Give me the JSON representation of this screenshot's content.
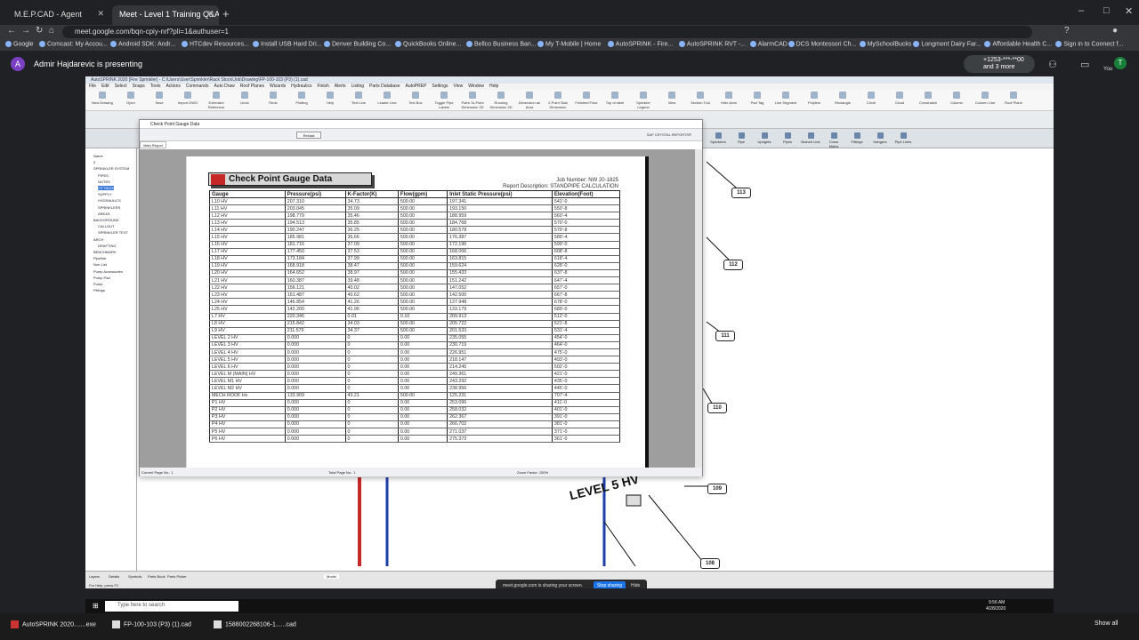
{
  "browser": {
    "tabs": [
      {
        "title": "M.E.P.CAD - Agent",
        "active": false
      },
      {
        "title": "Meet - Level 1 Training Q&A",
        "active": true
      }
    ],
    "url": "meet.google.com/bqn-cpiy-nrf?pli=1&authuser=1",
    "bookmarks": [
      "Google",
      "Comcast: My Accou...",
      "Android SDK: Andr...",
      "HTCdev Resources...",
      "Install USB Hard Dri...",
      "Denver Building Co...",
      "QuickBooks Online...",
      "Bellco Business Ban...",
      "My T-Mobile | Home",
      "AutoSPRINK - Fire...",
      "AutoSPRINK RVT -...",
      "AlarmCAD",
      "DCS Montessori Ch...",
      "MySchoolBucks",
      "Longmont Dairy Far...",
      "Affordable Health C...",
      "Sign in to Connect f..."
    ]
  },
  "meet": {
    "presenter_initial": "A",
    "presenter_text": "Admir Hajdarevic is presenting",
    "phone_text_1": "+1253-***-**00",
    "phone_text_2": "and 3 more",
    "you_label": "You",
    "you_initial": "T",
    "share_notice": "meet.google.com is sharing your screen.",
    "stop_sharing": "Stop sharing",
    "hide": "Hide"
  },
  "app": {
    "title": "AutoSPRINK 2020 [Fire Sprinkler] - C:\\Users\\User\\Sprinkler\\Rack Stock\\Job\\Drawing\\FP-100-103 (P3) (1).cad",
    "menu": [
      "File",
      "Edit",
      "Select",
      "Snaps",
      "Tools",
      "Actions",
      "Commands",
      "Auto Draw",
      "Roof Planes",
      "Wizards",
      "Hydraulics",
      "Finish",
      "Alerts",
      "Listing",
      "Parts Database",
      "AutoPREP",
      "Settings",
      "View",
      "Window",
      "Help"
    ],
    "ribbon": [
      "New Drawing",
      "Open",
      "Save",
      "Import DWG",
      "Extended Reference",
      "Undo",
      "Redo",
      "Plotting",
      "Help",
      "Text Line",
      "Leader Line",
      "Text Box",
      "Toggle Pipe Labels",
      "Point-To-Point Dimension 2D",
      "Running Dimension 2D",
      "Dimension an Area",
      "2-Point Slab Dimension",
      "Finished Floor",
      "Top of steel",
      "Sprinkler Legend",
      "View",
      "Section Tool",
      "Hide Area",
      "Part Tag",
      "Line Segment",
      "Polyline",
      "Rectangle",
      "Circle",
      "Cloud",
      "Crosshatch",
      "Column",
      "Column Line",
      "Roof Plane"
    ],
    "ribbon3": [
      "Sprinklers",
      "Pipe",
      "Uprights",
      "Pipes",
      "Branch Line",
      "Cross Mains",
      "Fittings",
      "Hangers",
      "Pipe Lines"
    ],
    "tree": [
      "Name",
      "0",
      "SPRINKLER SYSTEM",
      "PIPES",
      "NOTES",
      "FITTINGS",
      "SUPPLY",
      "HYDRAULICS",
      "SPRINKLERS",
      "AREAS",
      "BACKGROUND",
      "CALLOUT",
      "SPRINKLER TEXT",
      "ARCH",
      "DRAFTING",
      "BENCHMARK",
      "Pipeline",
      "Non-List",
      "Pump Accessories",
      "Pump Pad",
      "Pump",
      "Fittings"
    ],
    "bottom_tabs": [
      "Layers",
      "Details",
      "Symbols",
      "Parts Book",
      "Parts Picker"
    ],
    "model_tab": "Model",
    "status_help": "For Help, press F1",
    "labels": {
      "l113": "113",
      "l112": "112",
      "l111": "111",
      "l110": "110",
      "l109": "109",
      "l108": "108",
      "level5": "LEVEL 5 HV"
    }
  },
  "report": {
    "window_title": "Check Point Gauge Data",
    "reload": "Reload",
    "tab": "Main Report",
    "crystal": "SAP CRYSTAL REPORTS®",
    "heading": "Check Point Gauge Data",
    "job_number": "Job Number: NW 20-1825",
    "description": "Report Description: STANDPIPE CALCULATION",
    "columns": [
      "Gauge",
      "Pressure(psi)",
      "K-Factor(K)",
      "Flow(gpm)",
      "Inlet Static Pressure(psi)",
      "Elevation(Foot)"
    ],
    "rows": [
      [
        "L10 HV",
        "207.310",
        "34.73",
        "500.00",
        "197.341",
        "541'-0"
      ],
      [
        "L11 HV",
        "203.045",
        "35.09",
        "500.00",
        "193.150",
        "550'-8"
      ],
      [
        "L12 HV",
        "198.779",
        "35.46",
        "500.00",
        "188.959",
        "560'-4"
      ],
      [
        "L13 HV",
        "194.513",
        "35.85",
        "500.00",
        "184.768",
        "570'-0"
      ],
      [
        "L14 HV",
        "190.247",
        "36.25",
        "500.00",
        "180.578",
        "579'-8"
      ],
      [
        "L15 HV",
        "185.981",
        "36.66",
        "500.00",
        "176.387",
        "589'-4"
      ],
      [
        "L16 HV",
        "181.716",
        "37.09",
        "500.00",
        "172.196",
        "599'-0"
      ],
      [
        "L17 HV",
        "177.450",
        "37.53",
        "500.00",
        "168.006",
        "608'-8"
      ],
      [
        "L18 HV",
        "173.184",
        "37.99",
        "500.00",
        "163.815",
        "618'-4"
      ],
      [
        "L19 HV",
        "168.918",
        "38.47",
        "500.00",
        "159.624",
        "628'-0"
      ],
      [
        "L20 HV",
        "164.652",
        "38.97",
        "500.00",
        "155.433",
        "637'-8"
      ],
      [
        "L21 HV",
        "160.387",
        "39.48",
        "500.00",
        "151.242",
        "647'-4"
      ],
      [
        "L22 HV",
        "156.121",
        "40.02",
        "500.00",
        "147.052",
        "657'-0"
      ],
      [
        "L23 HV",
        "151.487",
        "40.62",
        "500.00",
        "142.500",
        "667'-8"
      ],
      [
        "L24 HV",
        "146.854",
        "41.26",
        "500.00",
        "137.948",
        "678'-0"
      ],
      [
        "L25 HV",
        "142.200",
        "41.96",
        "500.00",
        "133.179",
        "689'-0"
      ],
      [
        "L7 HV",
        "220.346",
        "0.01",
        "0.10",
        "209.913",
        "512'-0"
      ],
      [
        "L8 HV",
        "215.842",
        "34.03",
        "500.00",
        "205.722",
        "521'-8"
      ],
      [
        "L9 HV",
        "211.576",
        "34.37",
        "500.00",
        "201.533",
        "531'-4"
      ],
      [
        "LEVEL 2 HV",
        "0.000",
        "0",
        "0.00",
        "235.055",
        "454'-0"
      ],
      [
        "LEVEL 3 HV",
        "0.000",
        "0",
        "0.00",
        "230.719",
        "464'-0"
      ],
      [
        "LEVEL 4 HV",
        "0.000",
        "0",
        "0.00",
        "226.951",
        "475'-0"
      ],
      [
        "LEVEL 5 HV",
        "0.000",
        "0",
        "0.00",
        "218.147",
        "493'-0"
      ],
      [
        "LEVEL 6 HV",
        "0.000",
        "0",
        "0.00",
        "214.245",
        "502'-0"
      ],
      [
        "LEVEL M (MAIN) HV",
        "0.000",
        "0",
        "0.00",
        "249.361",
        "421'-0"
      ],
      [
        "LEVEL M1 HV",
        "0.000",
        "0",
        "0.00",
        "243.292",
        "435'-0"
      ],
      [
        "LEVEL M2 HV",
        "0.000",
        "0",
        "0.00",
        "238.956",
        "445'-0"
      ],
      [
        "MECH ROOF Hv",
        "133.909",
        "43.21",
        "500.00",
        "125.231",
        "707'-4"
      ],
      [
        "P1 HV",
        "0.000",
        "0",
        "0.00",
        "253.096",
        "411'-0"
      ],
      [
        "P2 HV",
        "0.000",
        "0",
        "0.00",
        "258.032",
        "401'-0"
      ],
      [
        "P3 HV",
        "0.000",
        "0",
        "0.00",
        "262.367",
        "391'-0"
      ],
      [
        "P4 HV",
        "0.000",
        "0",
        "0.00",
        "266.702",
        "381'-0"
      ],
      [
        "P5 HV",
        "0.000",
        "0",
        "0.00",
        "271.037",
        "371'-0"
      ],
      [
        "P6 HV",
        "0.000",
        "0",
        "0.00",
        "275.373",
        "361'-0"
      ]
    ],
    "status_left": "Current Page No.: 1",
    "status_mid": "Total Page No.: 1",
    "status_right": "Zoom Factor: 150%"
  },
  "taskbar": {
    "search": "Type here to search",
    "items": [
      "AutoSPRINK 2020.......exe",
      "FP-100-103 (P3) (1).cad",
      "1588002268106-1......cad"
    ],
    "show_all": "Show all",
    "time": "9:56 AM",
    "date": "4/28/2020"
  }
}
